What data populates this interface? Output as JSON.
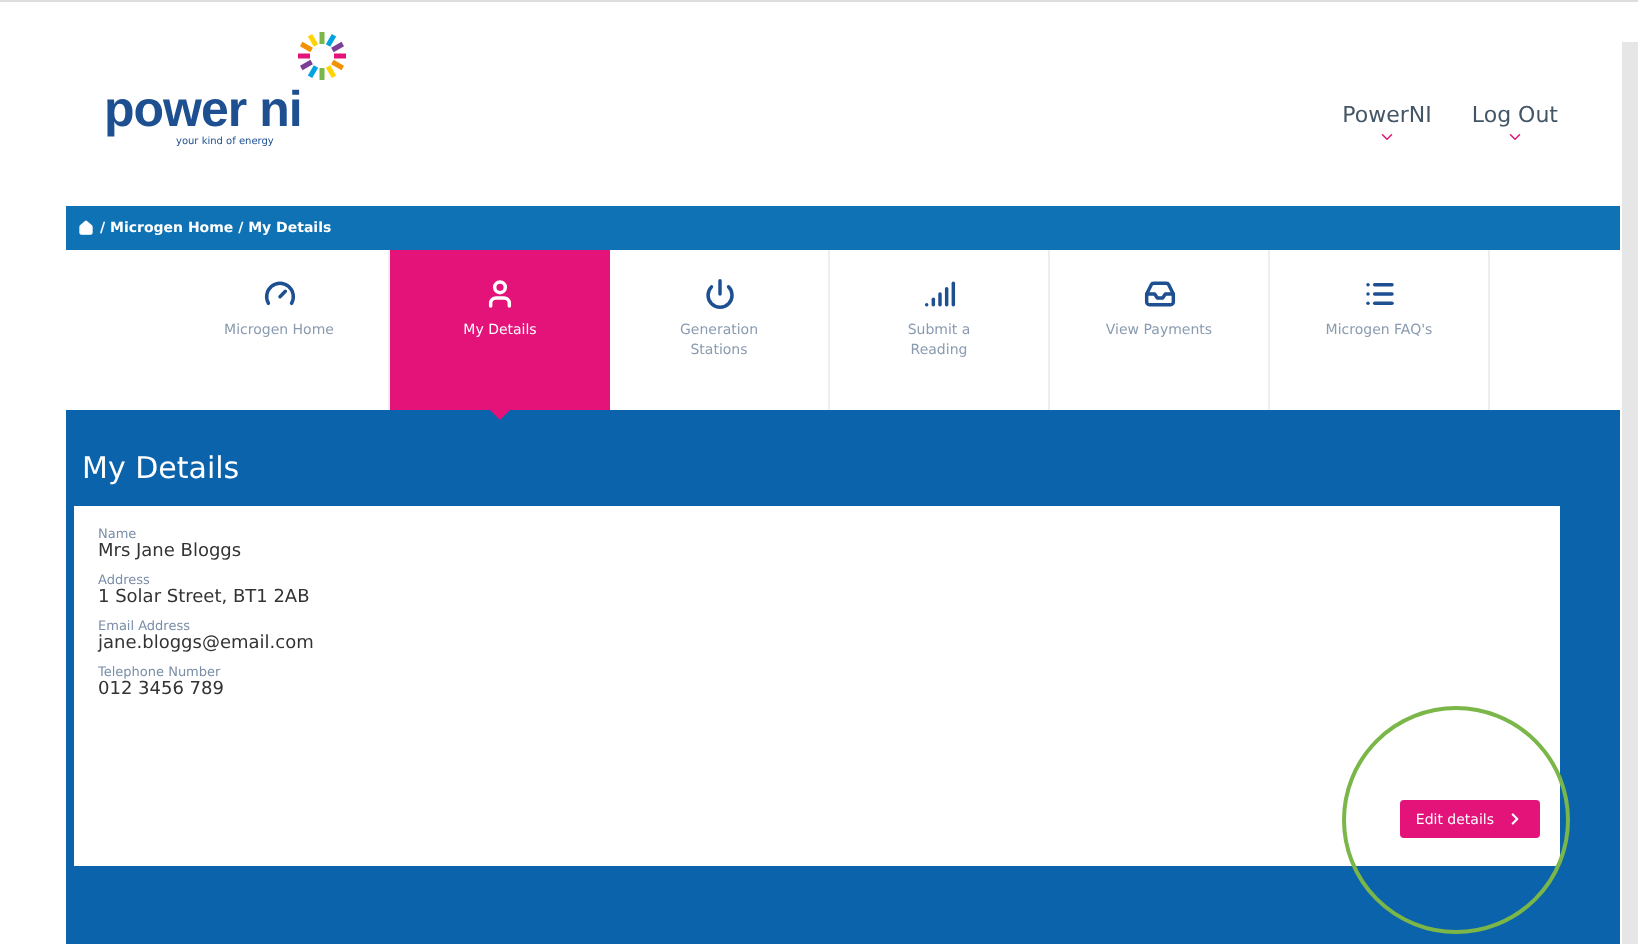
{
  "logo": {
    "name": "power ni",
    "tagline": "your kind of energy"
  },
  "header_links": [
    {
      "label": "PowerNI"
    },
    {
      "label": "Log Out"
    }
  ],
  "breadcrumb": "/ Microgen Home / My Details",
  "tabs": [
    {
      "label": "Microgen Home",
      "selected": false
    },
    {
      "label": "My Details",
      "selected": true
    },
    {
      "label": "Generation Stations",
      "selected": false
    },
    {
      "label": "Submit a Reading",
      "selected": false
    },
    {
      "label": "View Payments",
      "selected": false
    },
    {
      "label": "Microgen FAQ's",
      "selected": false
    }
  ],
  "page_title": "My Details",
  "fields": [
    {
      "label": "Name",
      "value": "Mrs Jane Bloggs"
    },
    {
      "label": "Address",
      "value": "1 Solar Street, BT1 2AB"
    },
    {
      "label": "Email Address",
      "value": "jane.bloggs@email.com"
    },
    {
      "label": "Telephone Number",
      "value": "012 3456 789"
    }
  ],
  "edit_button": "Edit details"
}
